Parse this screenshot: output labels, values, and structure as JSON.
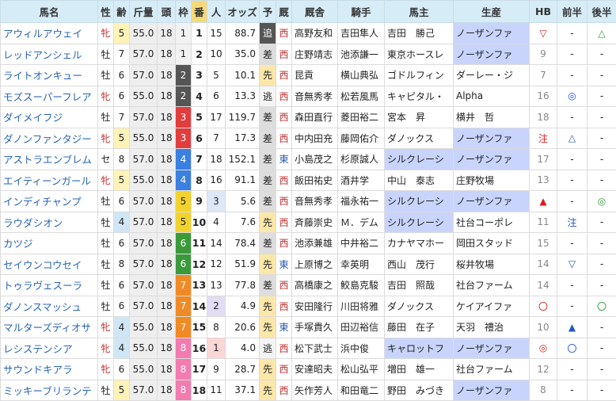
{
  "headers": {
    "name": "馬名",
    "sex": "性",
    "age": "齢",
    "weight": "斤量",
    "heads": "頭",
    "waku": "枠",
    "umaban": "番",
    "pop": "人",
    "odds": "オッズ",
    "yoso": "予",
    "zoku": "厩",
    "kyusha": "厩舎",
    "jockey": "騎手",
    "owner": "馬主",
    "breeder": "生産",
    "hb": "HB",
    "zenhan": "前半",
    "kohan": "後半"
  },
  "colors": {
    "waku1": "#ffffff",
    "waku2": "#555555",
    "waku3": "#e23d3d",
    "waku4": "#3b7fe0",
    "waku5": "#f2d32e",
    "waku6": "#3a9a3a",
    "waku7": "#f08a24",
    "waku8": "#f27bb0"
  },
  "rows": [
    {
      "name": "アウィルアウェイ",
      "sex": "牝",
      "age": "5",
      "weight": "55.0",
      "heads": "18",
      "waku": "1",
      "umaban": "1",
      "pop": "15",
      "odds": "88.7",
      "yoso": "追",
      "zoku": "西",
      "kyusha": "高野友和",
      "jockey": "吉田隼人",
      "owner": "吉田　勝己",
      "breeder": "ノーザンファ",
      "hb": "▽",
      "zenhan": "-",
      "kohan": "△",
      "hbc": "r",
      "zc": "k",
      "kc": "g"
    },
    {
      "name": "レッドアンシェル",
      "sex": "牡",
      "age": "7",
      "weight": "57.0",
      "heads": "18",
      "waku": "1",
      "umaban": "2",
      "pop": "10",
      "odds": "35.0",
      "yoso": "差",
      "zoku": "西",
      "kyusha": "庄野靖志",
      "jockey": "池添謙一",
      "owner": "東京ホースレ",
      "breeder": "ノーザンファ",
      "hb": "9",
      "zenhan": "-",
      "kohan": "-",
      "hbc": "gr",
      "zc": "k",
      "kc": "k"
    },
    {
      "name": "ライトオンキュー",
      "sex": "牡",
      "age": "6",
      "weight": "57.0",
      "heads": "18",
      "waku": "2",
      "umaban": "3",
      "pop": "5",
      "odds": "10.1",
      "yoso": "先",
      "zoku": "西",
      "kyusha": "昆貢",
      "jockey": "横山典弘",
      "owner": "ゴドルフィン",
      "breeder": "ダーレー・ジ",
      "hb": "7",
      "zenhan": "-",
      "kohan": "-",
      "hbc": "gr",
      "zc": "k",
      "kc": "k"
    },
    {
      "name": "モズスーパーフレア",
      "sex": "牝",
      "age": "6",
      "weight": "55.0",
      "heads": "18",
      "waku": "2",
      "umaban": "4",
      "pop": "6",
      "odds": "13.3",
      "yoso": "逃",
      "zoku": "西",
      "kyusha": "音無秀孝",
      "jockey": "松若風馬",
      "owner": "キャピタル・",
      "breeder": "Alpha",
      "hb": "16",
      "zenhan": "◎",
      "kohan": "-",
      "hbc": "gr",
      "zc": "b",
      "kc": "k"
    },
    {
      "name": "ダイメイフジ",
      "sex": "牡",
      "age": "7",
      "weight": "57.0",
      "heads": "18",
      "waku": "3",
      "umaban": "5",
      "pop": "17",
      "odds": "119.7",
      "yoso": "差",
      "zoku": "西",
      "kyusha": "森田直行",
      "jockey": "菱田裕二",
      "owner": "宮本　昇",
      "breeder": "横井　哲",
      "hb": "18",
      "zenhan": "-",
      "kohan": "-",
      "hbc": "gr",
      "zc": "k",
      "kc": "k"
    },
    {
      "name": "ダノンファンタジー",
      "sex": "牝",
      "age": "5",
      "weight": "55.0",
      "heads": "18",
      "waku": "3",
      "umaban": "6",
      "pop": "7",
      "odds": "17.3",
      "yoso": "差",
      "zoku": "西",
      "kyusha": "中内田充",
      "jockey": "藤岡佑介",
      "owner": "ダノックス",
      "breeder": "ノーザンファ",
      "hb": "注",
      "zenhan": "△",
      "kohan": "-",
      "hbc": "r",
      "zc": "b",
      "kc": "k"
    },
    {
      "name": "アストラエンブレム",
      "sex": "セ",
      "age": "8",
      "weight": "57.0",
      "heads": "18",
      "waku": "4",
      "umaban": "7",
      "pop": "18",
      "odds": "152.1",
      "yoso": "差",
      "zoku": "東",
      "kyusha": "小島茂之",
      "jockey": "杉原誠人",
      "owner": "シルクレーシ",
      "breeder": "ノーザンファ",
      "hb": "17",
      "zenhan": "-",
      "kohan": "-",
      "hbc": "gr",
      "zc": "k",
      "kc": "k"
    },
    {
      "name": "エイティーンガール",
      "sex": "牝",
      "age": "5",
      "weight": "55.0",
      "heads": "18",
      "waku": "4",
      "umaban": "8",
      "pop": "16",
      "odds": "91.1",
      "yoso": "差",
      "zoku": "西",
      "kyusha": "飯田祐史",
      "jockey": "酒井学",
      "owner": "中山　泰志",
      "breeder": "庄野牧場",
      "hb": "13",
      "zenhan": "-",
      "kohan": "-",
      "hbc": "gr",
      "zc": "k",
      "kc": "k"
    },
    {
      "name": "インディチャンプ",
      "sex": "牡",
      "age": "6",
      "weight": "57.0",
      "heads": "18",
      "waku": "5",
      "umaban": "9",
      "pop": "3",
      "odds": "5.6",
      "yoso": "差",
      "zoku": "西",
      "kyusha": "音無秀孝",
      "jockey": "福永祐一",
      "owner": "シルクレーシ",
      "breeder": "ノーザンファ",
      "hb": "▲",
      "zenhan": "-",
      "kohan": "◎",
      "hbc": "r",
      "zc": "k",
      "kc": "g"
    },
    {
      "name": "ラウダシオン",
      "sex": "牡",
      "age": "4",
      "weight": "57.0",
      "heads": "18",
      "waku": "5",
      "umaban": "10",
      "pop": "4",
      "odds": "7.6",
      "yoso": "先",
      "zoku": "西",
      "kyusha": "斉藤崇史",
      "jockey": "Ｍ．デム",
      "owner": "シルクレーシ",
      "breeder": "社台コーポレ",
      "hb": "11",
      "zenhan": "注",
      "zenc": "b",
      "kohan": "-",
      "hbc": "gr",
      "zc": "b",
      "kc": "k"
    },
    {
      "name": "カツジ",
      "sex": "牡",
      "age": "6",
      "weight": "57.0",
      "heads": "18",
      "waku": "6",
      "umaban": "11",
      "pop": "14",
      "odds": "78.4",
      "yoso": "差",
      "zoku": "西",
      "kyusha": "池添兼雄",
      "jockey": "中井裕二",
      "owner": "カナヤマホー",
      "breeder": "岡田スタッド",
      "hb": "15",
      "zenhan": "-",
      "kohan": "-",
      "hbc": "gr",
      "zc": "k",
      "kc": "k"
    },
    {
      "name": "セイウンコウセイ",
      "sex": "牡",
      "age": "8",
      "weight": "57.0",
      "heads": "18",
      "waku": "6",
      "umaban": "12",
      "pop": "12",
      "odds": "51.9",
      "yoso": "先",
      "zoku": "東",
      "kyusha": "上原博之",
      "jockey": "幸英明",
      "owner": "西山　茂行",
      "breeder": "桜井牧場",
      "hb": "14",
      "zenhan": "▽",
      "kohan": "-",
      "hbc": "gr",
      "zc": "b",
      "kc": "k"
    },
    {
      "name": "トゥラヴェスーラ",
      "sex": "牡",
      "age": "6",
      "weight": "57.0",
      "heads": "18",
      "waku": "7",
      "umaban": "13",
      "pop": "13",
      "odds": "77.8",
      "yoso": "差",
      "zoku": "西",
      "kyusha": "高橋康之",
      "jockey": "鮫島克駿",
      "owner": "吉田　照哉",
      "breeder": "社台ファーム",
      "hb": "14",
      "zenhan": "-",
      "kohan": "-",
      "hbc": "gr",
      "zc": "k",
      "kc": "k"
    },
    {
      "name": "ダノンスマッシュ",
      "sex": "牡",
      "age": "6",
      "weight": "57.0",
      "heads": "18",
      "waku": "7",
      "umaban": "14",
      "pop": "2",
      "odds": "4.9",
      "yoso": "先",
      "zoku": "西",
      "kyusha": "安田隆行",
      "jockey": "川田将雅",
      "owner": "ダノックス",
      "breeder": "ケイアイファ",
      "hb": "〇",
      "zenhan": "-",
      "kohan": "〇",
      "hbc": "r",
      "zc": "k",
      "kc": "g"
    },
    {
      "name": "マルターズディオサ",
      "sex": "牝",
      "age": "4",
      "weight": "55.0",
      "heads": "18",
      "waku": "7",
      "umaban": "15",
      "pop": "8",
      "odds": "20.6",
      "yoso": "先",
      "zoku": "東",
      "kyusha": "手塚貴久",
      "jockey": "田辺裕信",
      "owner": "藤田　在子",
      "breeder": "天羽　禮治",
      "hb": "10",
      "zenhan": "▲",
      "kohan": "-",
      "hbc": "gr",
      "zc": "b",
      "kc": "k"
    },
    {
      "name": "レシステンシア",
      "sex": "牝",
      "age": "4",
      "weight": "55.0",
      "heads": "18",
      "waku": "8",
      "umaban": "16",
      "pop": "1",
      "odds": "4.0",
      "yoso": "逃",
      "zoku": "西",
      "kyusha": "松下武士",
      "jockey": "浜中俊",
      "owner": "キャロットフ",
      "breeder": "ノーザンファ",
      "hb": "◎",
      "zenhan": "〇",
      "kohan": "-",
      "hbc": "r",
      "zc": "b",
      "kc": "k"
    },
    {
      "name": "サウンドキアラ",
      "sex": "牝",
      "age": "6",
      "weight": "55.0",
      "heads": "18",
      "waku": "8",
      "umaban": "17",
      "pop": "9",
      "odds": "28.7",
      "yoso": "先",
      "zoku": "西",
      "kyusha": "安達昭夫",
      "jockey": "松山弘平",
      "owner": "増田　雄一",
      "breeder": "社台ファーム",
      "hb": "12",
      "zenhan": "-",
      "kohan": "-",
      "hbc": "gr",
      "zc": "k",
      "kc": "k"
    },
    {
      "name": "ミッキーブリランテ",
      "sex": "牡",
      "age": "5",
      "weight": "57.0",
      "heads": "18",
      "waku": "8",
      "umaban": "18",
      "pop": "11",
      "odds": "37.1",
      "yoso": "先",
      "zoku": "西",
      "kyusha": "矢作芳人",
      "jockey": "和田竜二",
      "owner": "野田　みづき",
      "breeder": "ノーザンファ",
      "hb": "8",
      "zenhan": "-",
      "kohan": "-",
      "hbc": "gr",
      "zc": "k",
      "kc": "k"
    }
  ]
}
